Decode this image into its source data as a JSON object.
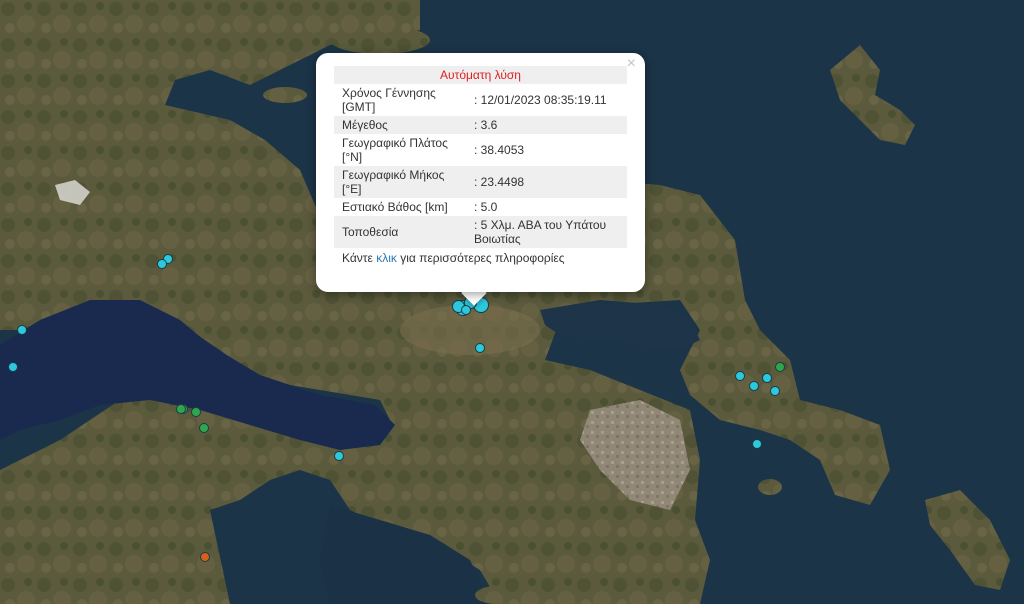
{
  "popup": {
    "title": "Αυτόματη λύση",
    "close_glyph": "×",
    "rows": [
      {
        "label": "Χρόνος Γέννησης [GMT]",
        "value": ": 12/01/2023 08:35:19.11"
      },
      {
        "label": "Μέγεθος",
        "value": ": 3.6"
      },
      {
        "label": "Γεωγραφικό Πλάτος [°N]",
        "value": ": 38.4053"
      },
      {
        "label": "Γεωγραφικό Μήκος [°E]",
        "value": ": 23.4498"
      },
      {
        "label": "Εστιακό Βάθος [km]",
        "value": ": 5.0"
      },
      {
        "label": "Τοποθεσία",
        "value": ": 5 Χλμ. ΑΒΑ του Υπάτου Βοιωτίας"
      }
    ],
    "more_prefix": "Κάντε ",
    "more_link": "κλικ",
    "more_suffix": " για περισσότερες πληροφορίες"
  },
  "colors": {
    "marker_cyan": "#2ec8dc",
    "marker_green": "#2ea64a",
    "marker_orange": "#d5601e",
    "sea": "#1c3447",
    "land": "#5a5a3a"
  },
  "markers": [
    {
      "color": "cyan",
      "size": "large"
    },
    {
      "color": "cyan",
      "size": "large"
    },
    {
      "color": "cyan",
      "size": "medium"
    },
    {
      "color": "cyan",
      "size": "medium"
    },
    {
      "color": "cyan",
      "size": "small"
    },
    {
      "color": "cyan",
      "size": "small"
    },
    {
      "color": "cyan",
      "size": "small"
    },
    {
      "color": "cyan",
      "size": "small"
    },
    {
      "color": "cyan",
      "size": "small"
    },
    {
      "color": "cyan",
      "size": "small"
    },
    {
      "color": "cyan",
      "size": "small"
    },
    {
      "color": "cyan",
      "size": "small"
    },
    {
      "color": "cyan",
      "size": "small"
    },
    {
      "color": "cyan",
      "size": "small"
    },
    {
      "color": "cyan",
      "size": "small"
    },
    {
      "color": "cyan",
      "size": "small"
    },
    {
      "color": "green",
      "size": "small"
    },
    {
      "color": "green",
      "size": "small"
    },
    {
      "color": "green",
      "size": "small"
    },
    {
      "color": "green",
      "size": "small"
    },
    {
      "color": "green",
      "size": "small"
    },
    {
      "color": "orange",
      "size": "small"
    }
  ]
}
